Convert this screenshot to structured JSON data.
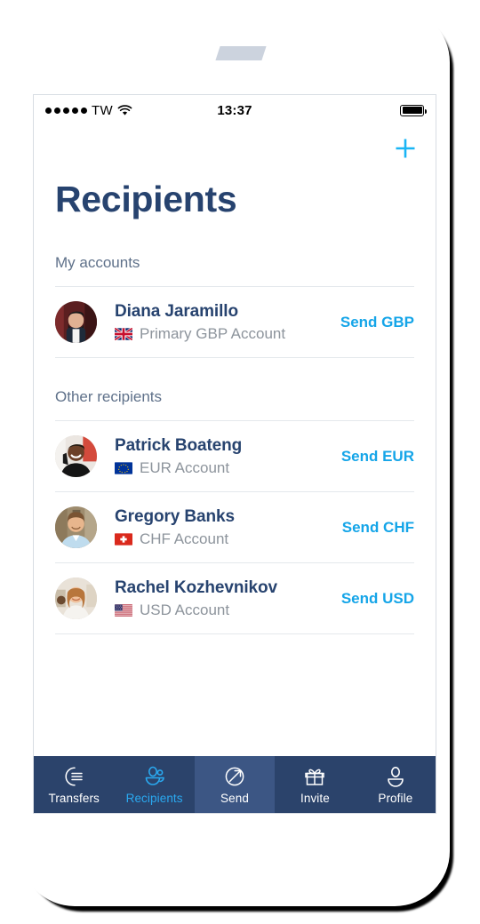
{
  "status_bar": {
    "signal_dots": 5,
    "carrier": "TW",
    "wifi_icon": "wifi-icon",
    "time": "13:37",
    "battery_icon": "battery-full-icon"
  },
  "topbar": {
    "add_icon": "plus-icon",
    "add_color": "#19b5f5"
  },
  "header": {
    "title": "Recipients",
    "title_color": "#27436f"
  },
  "sections": [
    {
      "id": "my-accounts",
      "title": "My accounts",
      "rows": [
        {
          "name": "Diana Jaramillo",
          "account": "Primary GBP Account",
          "flag": "flag-gb",
          "flag_alt": "United Kingdom flag",
          "action": "Send GBP",
          "avatar": "avatar-diana-jaramillo"
        }
      ]
    },
    {
      "id": "other-recipients",
      "title": "Other recipients",
      "rows": [
        {
          "name": "Patrick Boateng",
          "account": "EUR Account",
          "flag": "flag-eu",
          "flag_alt": "European Union flag",
          "action": "Send EUR",
          "avatar": "avatar-patrick-boateng"
        },
        {
          "name": "Gregory Banks",
          "account": "CHF Account",
          "flag": "flag-ch",
          "flag_alt": "Switzerland flag",
          "action": "Send CHF",
          "avatar": "avatar-gregory-banks"
        },
        {
          "name": "Rachel Kozhevnikov",
          "account": "USD Account",
          "flag": "flag-us",
          "flag_alt": "United States flag",
          "action": "Send USD",
          "avatar": "avatar-rachel-kozhevnikov"
        }
      ]
    }
  ],
  "tabbar": {
    "background": "#2b436b",
    "raised_background": "#3c5684",
    "active_color": "#2aa9f0",
    "inactive_color": "#ffffff",
    "items": [
      {
        "label": "Transfers",
        "icon": "transfers-icon",
        "active": false,
        "raised": false
      },
      {
        "label": "Recipients",
        "icon": "recipients-icon",
        "active": true,
        "raised": false
      },
      {
        "label": "Send",
        "icon": "send-icon",
        "active": false,
        "raised": true
      },
      {
        "label": "Invite",
        "icon": "invite-gift-icon",
        "active": false,
        "raised": false
      },
      {
        "label": "Profile",
        "icon": "profile-icon",
        "active": false,
        "raised": false
      }
    ]
  }
}
